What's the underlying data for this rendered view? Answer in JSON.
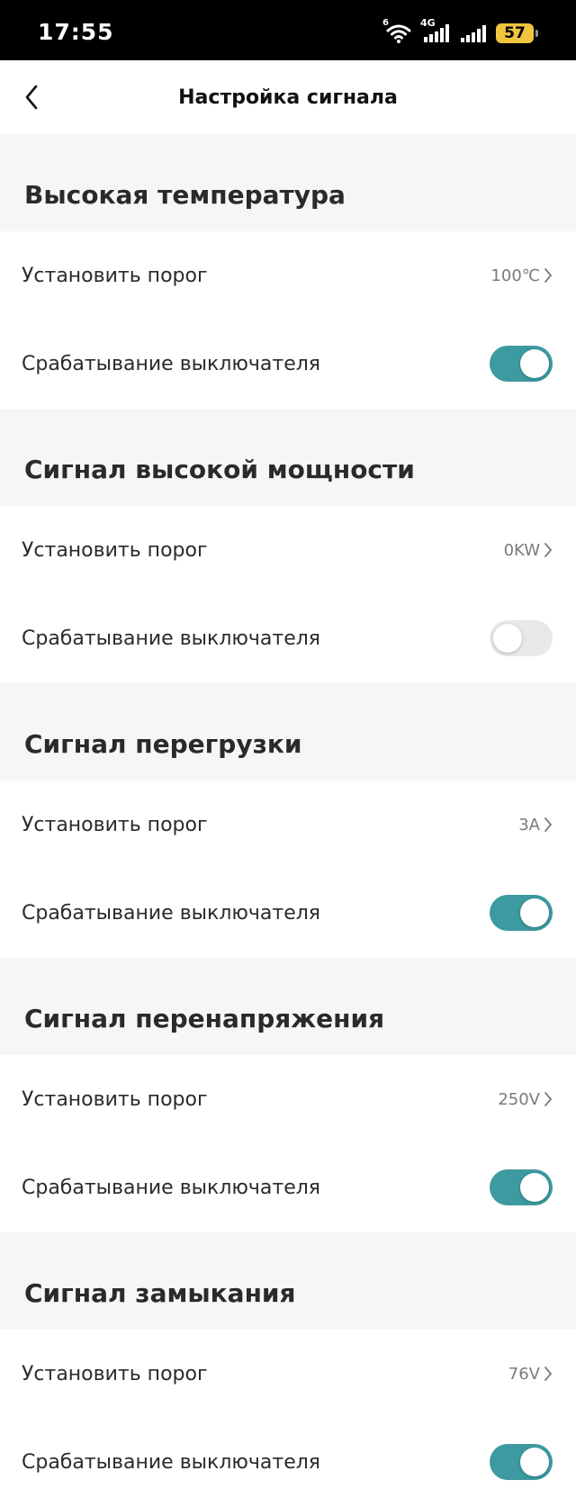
{
  "status_bar": {
    "time": "17:55",
    "wifi_sup": "6",
    "network_label": "4G",
    "battery": "57",
    "battery_color": "#efc43e"
  },
  "header": {
    "title": "Настройка сигнала",
    "back_icon": "chevron-left-icon"
  },
  "accent_color": "#3c9aa0",
  "sections": [
    {
      "title": "Высокая температура",
      "threshold_label": "Установить порог",
      "threshold_value": "100℃",
      "switch_label": "Срабатывание выключателя",
      "switch_on": true
    },
    {
      "title": "Сигнал высокой мощности",
      "threshold_label": "Установить порог",
      "threshold_value": "0KW",
      "switch_label": "Срабатывание выключателя",
      "switch_on": false
    },
    {
      "title": "Сигнал перегрузки",
      "threshold_label": "Установить порог",
      "threshold_value": "3A",
      "switch_label": "Срабатывание выключателя",
      "switch_on": true
    },
    {
      "title": "Сигнал перенапряжения",
      "threshold_label": "Установить порог",
      "threshold_value": "250V",
      "switch_label": "Срабатывание выключателя",
      "switch_on": true
    },
    {
      "title": "Сигнал замыкания",
      "threshold_label": "Установить порог",
      "threshold_value": "76V",
      "switch_label": "Срабатывание выключателя",
      "switch_on": true
    }
  ]
}
